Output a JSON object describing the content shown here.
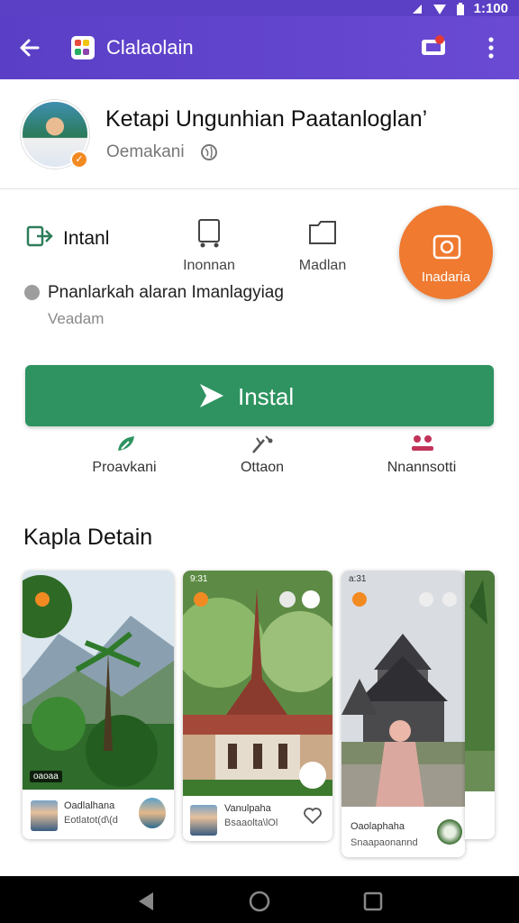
{
  "status_bar": {
    "time": "1:100",
    "icons": [
      "signal-icon",
      "wifi-icon",
      "battery-icon"
    ]
  },
  "app_bar": {
    "title": "Clalaolain",
    "icons": [
      "back-arrow-icon",
      "app-grid-icon",
      "cast-icon",
      "more-vert-icon"
    ]
  },
  "header": {
    "name": "Ketapi Ungunhian Paatanloglan’",
    "subtitle": "Oemakani"
  },
  "features": {
    "primary_label": "Intanl",
    "items": [
      {
        "label": "Inonnan",
        "icon": "device-icon"
      },
      {
        "label": "Madlan",
        "icon": "folder-icon"
      }
    ],
    "fab_label": "Inadaria",
    "note": "Pnanlarkah alaran Imanlagyiag",
    "note_sub": "Veadam"
  },
  "install_button": {
    "label": "Instal",
    "color": "#2e9360"
  },
  "actions": [
    {
      "label": "Proavkani",
      "icon": "share-leaf-icon",
      "color": "#2e9360"
    },
    {
      "label": "Ottaon",
      "icon": "wand-icon",
      "color": "#555555"
    },
    {
      "label": "Nnannsotti",
      "icon": "people-icon",
      "color": "#c2335a"
    }
  ],
  "section": {
    "title": "Kapla Detain"
  },
  "cards": [
    {
      "user": "Oadlalhana",
      "meta": "Eotlatot(d\\(d",
      "caption": "oaoaa"
    },
    {
      "user": "Vanulpaha",
      "meta": "Bsaaolta\\lOl",
      "time": "9:31"
    },
    {
      "user": "Oaolaphaha",
      "meta": "Snaapaonannd",
      "time": "a:31"
    }
  ],
  "colors": {
    "brand": "#5b3fc4",
    "accent": "#ef7a30"
  }
}
